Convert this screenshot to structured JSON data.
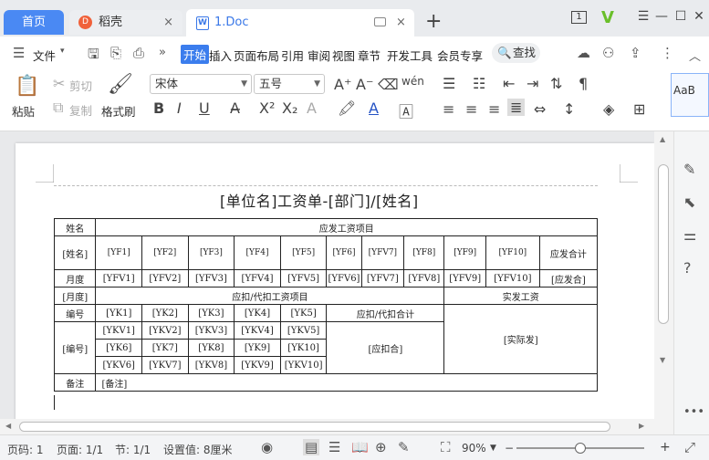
{
  "tabs": {
    "home": "首页",
    "daoke": "稻壳",
    "doc": "1.Doc",
    "close": "×",
    "add": "+"
  },
  "window": {
    "count": "1",
    "min": "—",
    "max": "☐",
    "close": "✕"
  },
  "menu": {
    "file": "文件",
    "items": [
      "开始",
      "插入",
      "页面布局",
      "引用",
      "审阅",
      "视图",
      "章节",
      "开发工具",
      "会员专享"
    ],
    "search": "查找"
  },
  "ribbon": {
    "paste": "粘贴",
    "cut": "剪切",
    "copy": "复制",
    "format_painter": "格式刷",
    "font_name": "宋体",
    "font_size": "五号",
    "style_preview": "AaB"
  },
  "doc": {
    "title": "[单位名]工资单-[部门]/[姓名]",
    "table": {
      "r1": [
        "姓名",
        "应发工资项目"
      ],
      "r2": [
        "[姓名]",
        "[YF1]",
        "[YF2]",
        "[YF3]",
        "[YF4]",
        "[YF5]",
        "[YF6]",
        "[YFV7]",
        "[YF8]",
        "[YF9]",
        "[YF10]",
        "应发合计"
      ],
      "r3": [
        "月度",
        "[YFV1]",
        "[YFV2]",
        "[YFV3]",
        "[YFV4]",
        "[YFV5]",
        "[YFV6]",
        "[YFV7]",
        "[YFV8]",
        "[YFV9]",
        "[YFV10]",
        "[应发合]"
      ],
      "r4": [
        "[月度]",
        "应扣/代扣工资项目",
        "实发工资"
      ],
      "r5": [
        "编号",
        "[YK1]",
        "[YK2]",
        "[YK3]",
        "[YK4]",
        "[YK5]",
        "应扣/代扣合计",
        "[实际发]"
      ],
      "r6": [
        "[编号]",
        "[YKV1]",
        "[YKV2]",
        "[YKV3]",
        "[YKV4]",
        "[YKV5]",
        "[应扣合]"
      ],
      "r7": [
        "[YK6]",
        "[YK7]",
        "[YK8]",
        "[YK9]",
        "[YK10]"
      ],
      "r8": [
        "[YKV6]",
        "[YKV7]",
        "[YKV8]",
        "[YKV9]",
        "[YKV10]"
      ],
      "r9": [
        "备注",
        "[备注]"
      ]
    }
  },
  "status": {
    "page_num": "页码: 1",
    "pages": "页面: 1/1",
    "section": "节: 1/1",
    "setting": "设置值: 8厘米",
    "zoom": "90%"
  }
}
